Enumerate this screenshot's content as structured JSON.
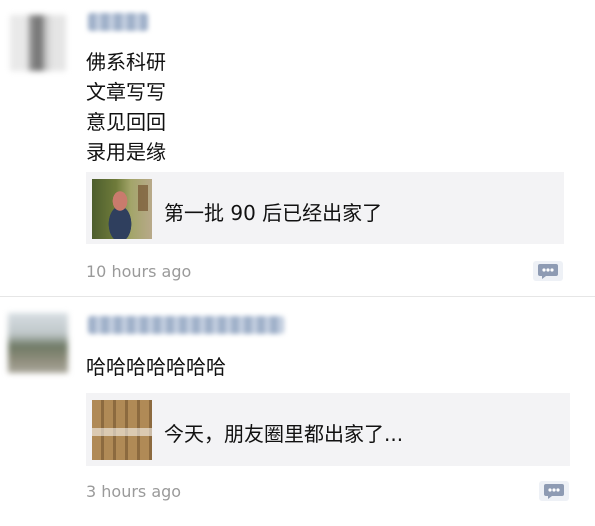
{
  "posts": [
    {
      "text": "佛系科研\n文章写写\n意见回回\n录用是缘",
      "share_title": "第一批 90 后已经出家了",
      "time": "10 hours ago"
    },
    {
      "text": "哈哈哈哈哈哈哈",
      "share_title": "今天，朋友圈里都出家了...",
      "time": "3 hours ago"
    }
  ],
  "icons": {
    "comment": "comment-more-icon"
  },
  "colors": {
    "name_blur": "#9fb0c9",
    "time": "#9a9a9a",
    "share_bg": "#f3f3f5",
    "icon": "#8e9bb3"
  }
}
